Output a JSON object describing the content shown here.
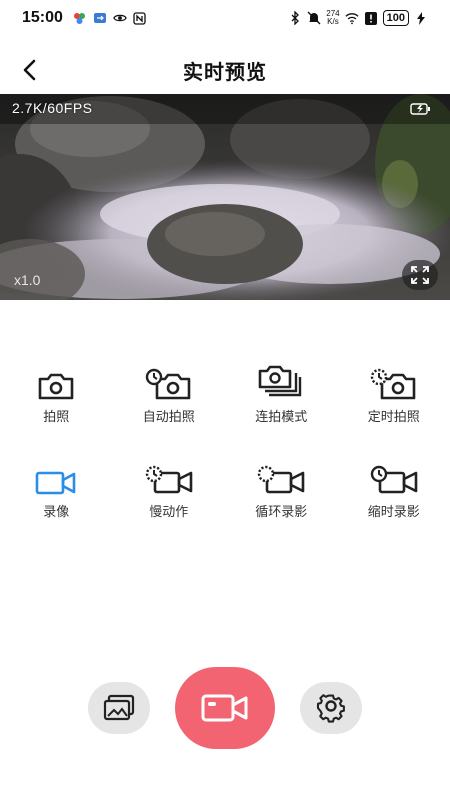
{
  "status_bar": {
    "time": "15:00",
    "net_speed_value": "274",
    "net_speed_unit": "K/s",
    "battery": "100"
  },
  "header": {
    "title": "实时预览"
  },
  "preview": {
    "resolution_label": "2.7K/60FPS",
    "zoom_label": "x1.0"
  },
  "modes": {
    "row1": [
      {
        "label": "拍照",
        "icon": "camera-icon"
      },
      {
        "label": "自动拍照",
        "icon": "auto-camera-icon"
      },
      {
        "label": "连拍模式",
        "icon": "burst-camera-icon"
      },
      {
        "label": "定时拍照",
        "icon": "timer-camera-icon"
      }
    ],
    "row2": [
      {
        "label": "录像",
        "icon": "video-icon"
      },
      {
        "label": "慢动作",
        "icon": "slow-motion-video-icon"
      },
      {
        "label": "循环录影",
        "icon": "loop-video-icon"
      },
      {
        "label": "缩时录影",
        "icon": "timelapse-video-icon"
      }
    ]
  },
  "colors": {
    "accent_blue": "#2a8de8",
    "record_button": "#f26471",
    "dark_icon": "#222222"
  }
}
